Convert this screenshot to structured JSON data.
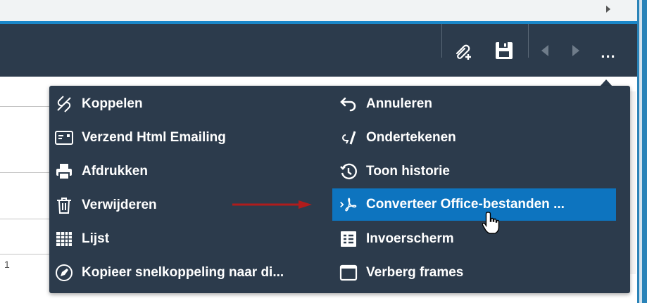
{
  "grid": {
    "row_number": "1"
  },
  "toolbar": {
    "buttons": [
      {
        "name": "attach-add",
        "icon": "paperclip-plus-icon"
      },
      {
        "name": "save",
        "icon": "floppy-disk-icon"
      },
      {
        "name": "previous",
        "icon": "chevron-left-icon"
      },
      {
        "name": "next",
        "icon": "chevron-right-icon"
      },
      {
        "name": "more",
        "label": "..."
      }
    ]
  },
  "menu": {
    "left": [
      {
        "label": "Koppelen",
        "icon": "link-icon"
      },
      {
        "label": "Verzend Html Emailing",
        "icon": "email-card-icon"
      },
      {
        "label": "Afdrukken",
        "icon": "printer-icon"
      },
      {
        "label": "Verwijderen",
        "icon": "trash-icon"
      },
      {
        "label": "Lijst",
        "icon": "list-icon"
      },
      {
        "label": "Kopieer snelkoppeling naar di...",
        "icon": "pin-icon"
      }
    ],
    "right": [
      {
        "label": "Annuleren",
        "icon": "undo-icon"
      },
      {
        "label": "Ondertekenen",
        "icon": "signature-icon"
      },
      {
        "label": "Toon historie",
        "icon": "history-icon"
      },
      {
        "label": "Converteer Office-bestanden ...",
        "icon": "pdf-icon",
        "highlighted": true
      },
      {
        "label": "Invoerscherm",
        "icon": "form-icon"
      },
      {
        "label": "Verberg frames",
        "icon": "window-icon"
      }
    ]
  },
  "colors": {
    "header_bg": "#2c3b4c",
    "menu_bg": "#2c3b4c",
    "highlight": "#0d74bf",
    "accent_blue": "#1b87c9",
    "annotation_arrow": "#b01c1c"
  }
}
